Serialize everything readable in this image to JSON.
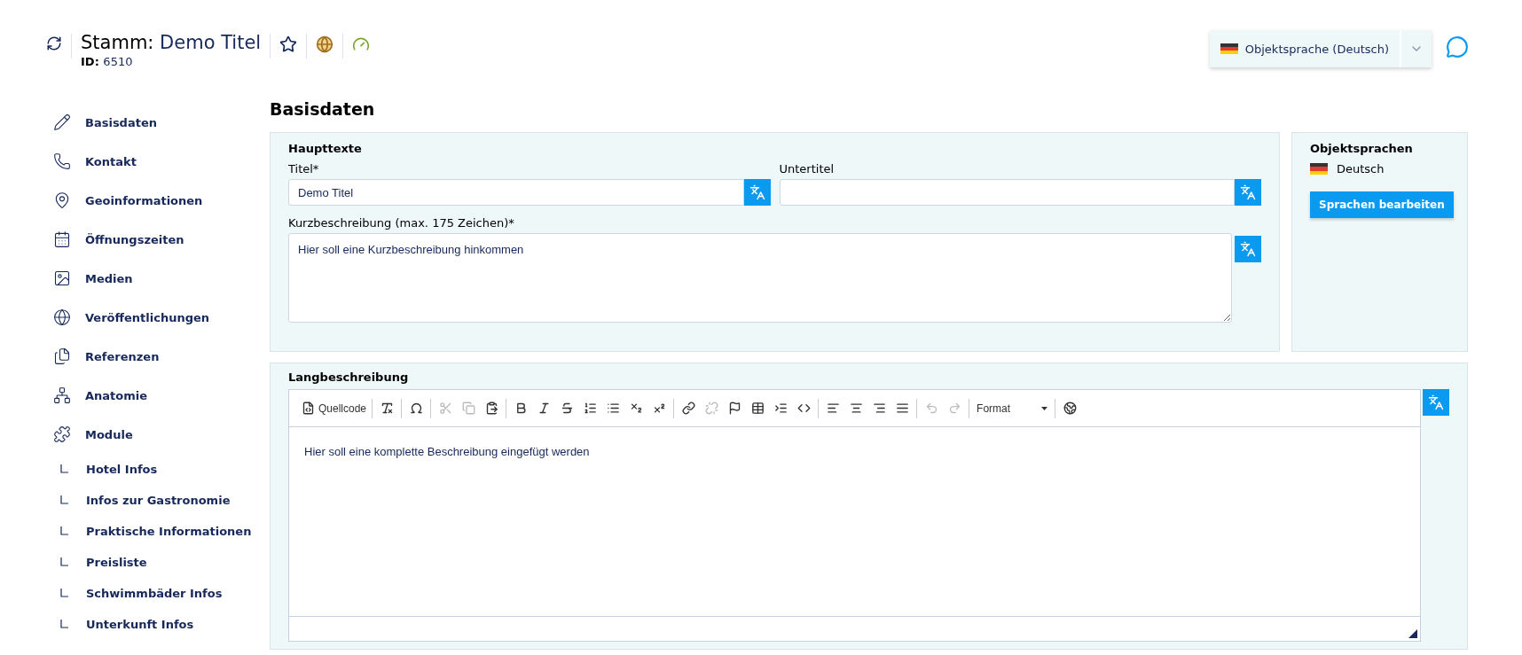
{
  "header": {
    "prefix": "Stamm:",
    "title": "Demo Titel",
    "id_label": "ID:",
    "id_value": "6510",
    "language_select": "Objektsprache (Deutsch)"
  },
  "sidebar": {
    "items": [
      {
        "kind": "pencil",
        "label": "Basisdaten"
      },
      {
        "kind": "phone",
        "label": "Kontakt"
      },
      {
        "kind": "pin",
        "label": "Geoinformationen"
      },
      {
        "kind": "calendar",
        "label": "Öffnungszeiten"
      },
      {
        "kind": "image",
        "label": "Medien"
      },
      {
        "kind": "globe",
        "label": "Veröffentlichungen"
      },
      {
        "kind": "files",
        "label": "Referenzen"
      },
      {
        "kind": "network",
        "label": "Anatomie"
      },
      {
        "kind": "puzzle",
        "label": "Module",
        "children": [
          {
            "label": "Hotel Infos"
          },
          {
            "label": "Infos zur Gastronomie"
          },
          {
            "label": "Praktische Informationen"
          },
          {
            "label": "Preisliste"
          },
          {
            "label": "Schwimmbäder Infos"
          },
          {
            "label": "Unterkunft Infos"
          }
        ]
      }
    ]
  },
  "page_title": "Basisdaten",
  "haupttexte": {
    "title": "Haupttexte",
    "fields": [
      {
        "label": "Titel*",
        "value": "Demo Titel"
      },
      {
        "label": "Untertitel"
      }
    ],
    "short_label": "Kurzbeschreibung (max. 175 Zeichen)*",
    "short_value": "Hier soll eine Kurzbeschreibung hinkommen"
  },
  "languages": {
    "title": "Objektsprachen",
    "items": [
      {
        "label": "Deutsch"
      }
    ],
    "button": "Sprachen bearbeiten"
  },
  "long": {
    "title": "Langbeschreibung",
    "content": "Hier soll eine komplette Beschreibung eingefügt werden",
    "toolbar": [
      [
        {
          "kind": "source",
          "label": "Quellcode",
          "disabled": false
        }
      ],
      [
        {
          "kind": "removeformat",
          "disabled": false
        }
      ],
      [
        {
          "kind": "omega",
          "disabled": false
        }
      ],
      [
        {
          "kind": "cut",
          "disabled": true
        },
        {
          "kind": "copy",
          "disabled": true
        },
        {
          "kind": "paste",
          "disabled": false
        }
      ],
      [
        {
          "kind": "bold",
          "disabled": false
        },
        {
          "kind": "italic",
          "disabled": false
        },
        {
          "kind": "strike",
          "disabled": false
        },
        {
          "kind": "ol",
          "disabled": false
        },
        {
          "kind": "ul",
          "disabled": false
        },
        {
          "kind": "sub",
          "disabled": false
        },
        {
          "kind": "sup",
          "disabled": false
        }
      ],
      [
        {
          "kind": "link",
          "disabled": false
        },
        {
          "kind": "unlink",
          "disabled": true
        },
        {
          "kind": "flag",
          "disabled": false
        },
        {
          "kind": "table",
          "disabled": false
        },
        {
          "kind": "indent",
          "disabled": false
        },
        {
          "kind": "div",
          "disabled": false
        }
      ],
      [
        {
          "kind": "alignleft",
          "disabled": false
        },
        {
          "kind": "aligncenter",
          "disabled": false
        },
        {
          "kind": "alignright",
          "disabled": false
        },
        {
          "kind": "justify",
          "disabled": false
        }
      ],
      [
        {
          "kind": "undo",
          "disabled": true
        },
        {
          "kind": "redo",
          "disabled": true
        }
      ],
      [
        {
          "kind": "dropdown",
          "label": "Format"
        }
      ],
      [
        {
          "kind": "earth",
          "disabled": false
        }
      ]
    ]
  }
}
